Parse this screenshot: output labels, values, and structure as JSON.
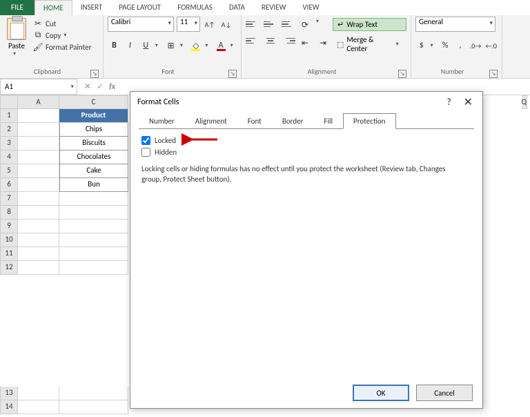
{
  "ribbon": {
    "tabs": [
      "FILE",
      "HOME",
      "INSERT",
      "PAGE LAYOUT",
      "FORMULAS",
      "DATA",
      "REVIEW",
      "VIEW"
    ],
    "active_tab": "HOME",
    "clipboard": {
      "paste": "Paste",
      "cut": "Cut",
      "copy": "Copy",
      "painter": "Format Painter",
      "group": "Clipboard"
    },
    "font": {
      "name": "Calibri",
      "size": "11",
      "group": "Font"
    },
    "alignment": {
      "wrap": "Wrap Text",
      "merge": "Merge & Center",
      "group": "Alignment"
    },
    "number": {
      "format": "General",
      "group": "Number"
    }
  },
  "namebox": {
    "ref": "A1"
  },
  "columns": [
    "A",
    "C"
  ],
  "row_numbers": [
    1,
    2,
    3,
    4,
    5,
    6,
    7,
    8,
    9,
    10,
    11,
    12
  ],
  "extra_rows": [
    13,
    14
  ],
  "table": {
    "header": "Product",
    "rows": [
      "Chips",
      "Biscuits",
      "Chocolates",
      "Cake",
      "Bun"
    ]
  },
  "dialog": {
    "title": "Format Cells",
    "tabs": [
      "Number",
      "Alignment",
      "Font",
      "Border",
      "Fill",
      "Protection"
    ],
    "active_tab": "Protection",
    "locked": {
      "label": "Locked",
      "checked": true
    },
    "hidden": {
      "label": "Hidden",
      "checked": false
    },
    "hint": "Locking cells or hiding formulas has no effect until you protect the worksheet (Review tab, Changes group, Protect Sheet button).",
    "ok": "OK",
    "cancel": "Cancel"
  },
  "right_col": "Q"
}
